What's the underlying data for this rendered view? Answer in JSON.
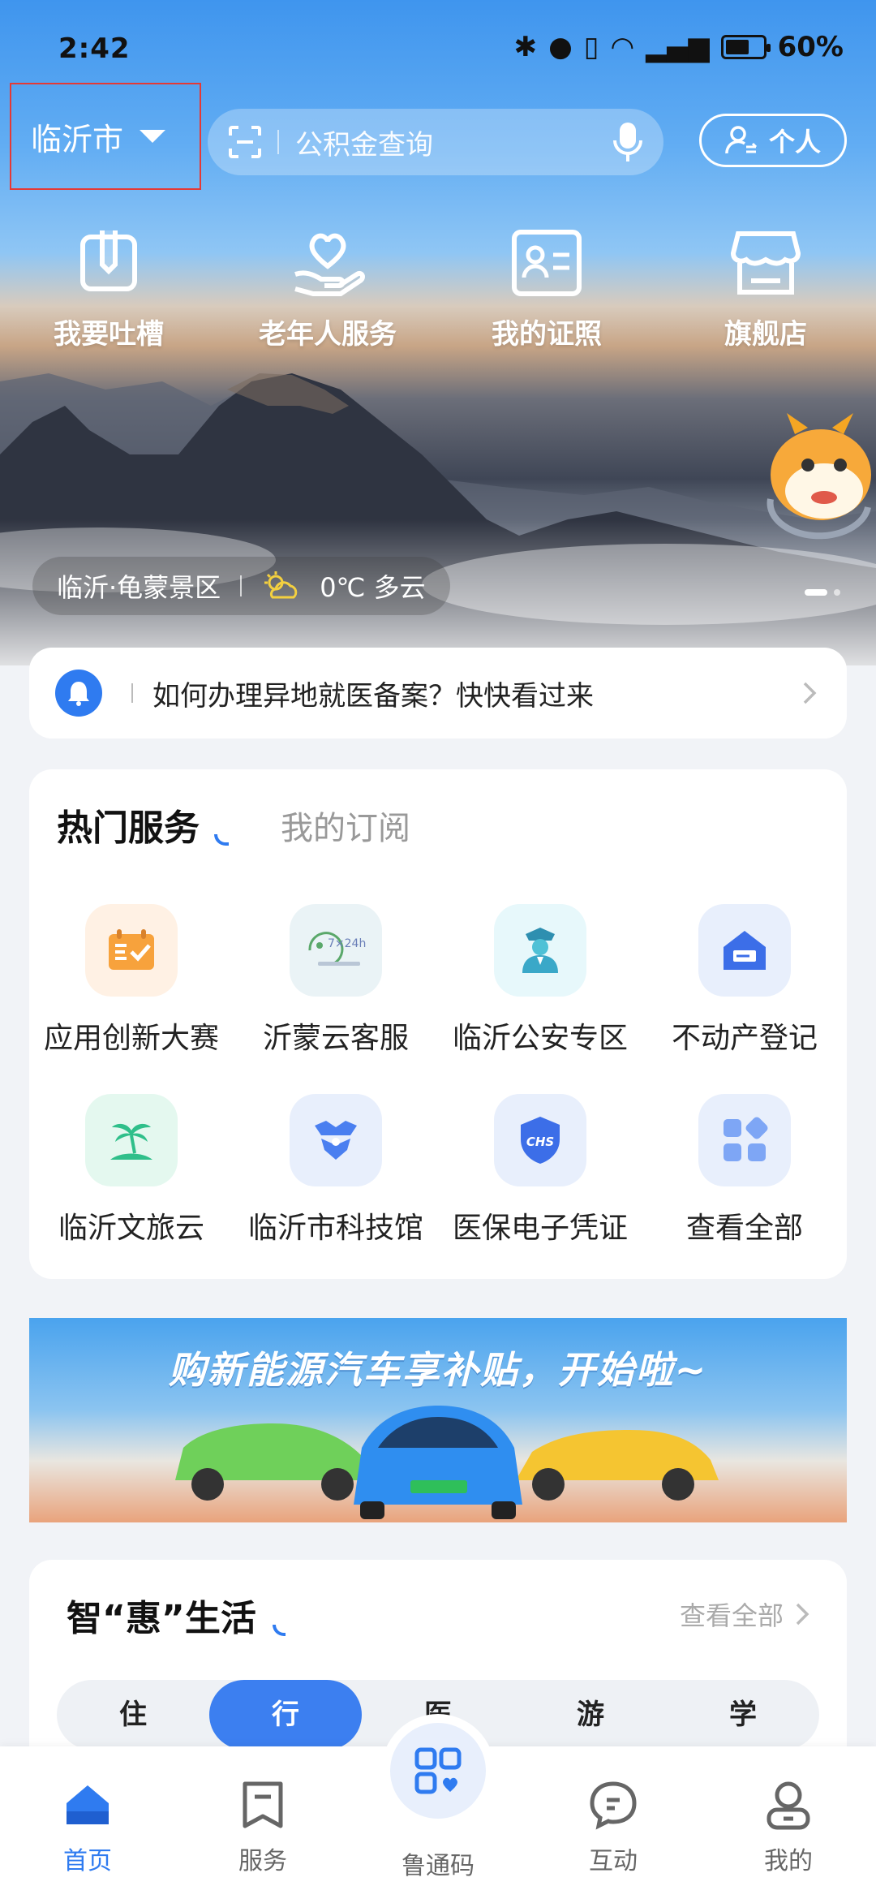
{
  "status_bar": {
    "time": "2:42",
    "battery": "60%"
  },
  "header": {
    "city": "临沂市",
    "search_placeholder": "公积金查询",
    "personal_label": "个人"
  },
  "quick_actions": [
    {
      "label": "我要吐槽",
      "icon": "feedback-icon"
    },
    {
      "label": "老年人服务",
      "icon": "heart-hand-icon"
    },
    {
      "label": "我的证照",
      "icon": "id-card-icon"
    },
    {
      "label": "旗舰店",
      "icon": "store-icon"
    }
  ],
  "hero": {
    "location": "临沂·龟蒙景区",
    "weather": "0℃ 多云"
  },
  "notice": {
    "text": "如何办理异地就医备案？快快看过来"
  },
  "hot_services": {
    "tab_active": "热门服务",
    "tab_inactive": "我的订阅",
    "items": [
      {
        "label": "应用创新大赛",
        "icon": "contest-icon",
        "color": "#f7a23c"
      },
      {
        "label": "沂蒙云客服",
        "icon": "customer-service-icon",
        "color": "#5aa86a"
      },
      {
        "label": "临沂公安专区",
        "icon": "police-icon",
        "color": "#3aa8c8"
      },
      {
        "label": "不动产登记",
        "icon": "house-icon",
        "color": "#3c6ee8"
      },
      {
        "label": "临沂文旅云",
        "icon": "palm-tree-icon",
        "color": "#2fbf8a"
      },
      {
        "label": "临沂市科技馆",
        "icon": "science-museum-icon",
        "color": "#4a7ff0"
      },
      {
        "label": "医保电子凭证",
        "icon": "chs-shield-icon",
        "color": "#3c6ee8"
      },
      {
        "label": "查看全部",
        "icon": "grid-apps-icon",
        "color": "#7ea6f5"
      }
    ]
  },
  "banner": {
    "text": "购新能源汽车享补贴，开始啦~"
  },
  "life": {
    "title": "智“惠”生活",
    "more": "查看全部",
    "tabs": [
      "住",
      "行",
      "医",
      "游",
      "学"
    ],
    "active_tab": "行"
  },
  "bottom_nav": [
    {
      "label": "首页",
      "icon": "home-icon",
      "active": true
    },
    {
      "label": "服务",
      "icon": "bookmark-icon",
      "active": false
    },
    {
      "label": "鲁通码",
      "icon": "qr-code-icon",
      "active": false
    },
    {
      "label": "互动",
      "icon": "chat-icon",
      "active": false
    },
    {
      "label": "我的",
      "icon": "user-icon",
      "active": false
    }
  ],
  "colors": {
    "primary": "#2f7bf0",
    "sky": "#3f95ee",
    "page_bg": "#f1f3f7"
  }
}
